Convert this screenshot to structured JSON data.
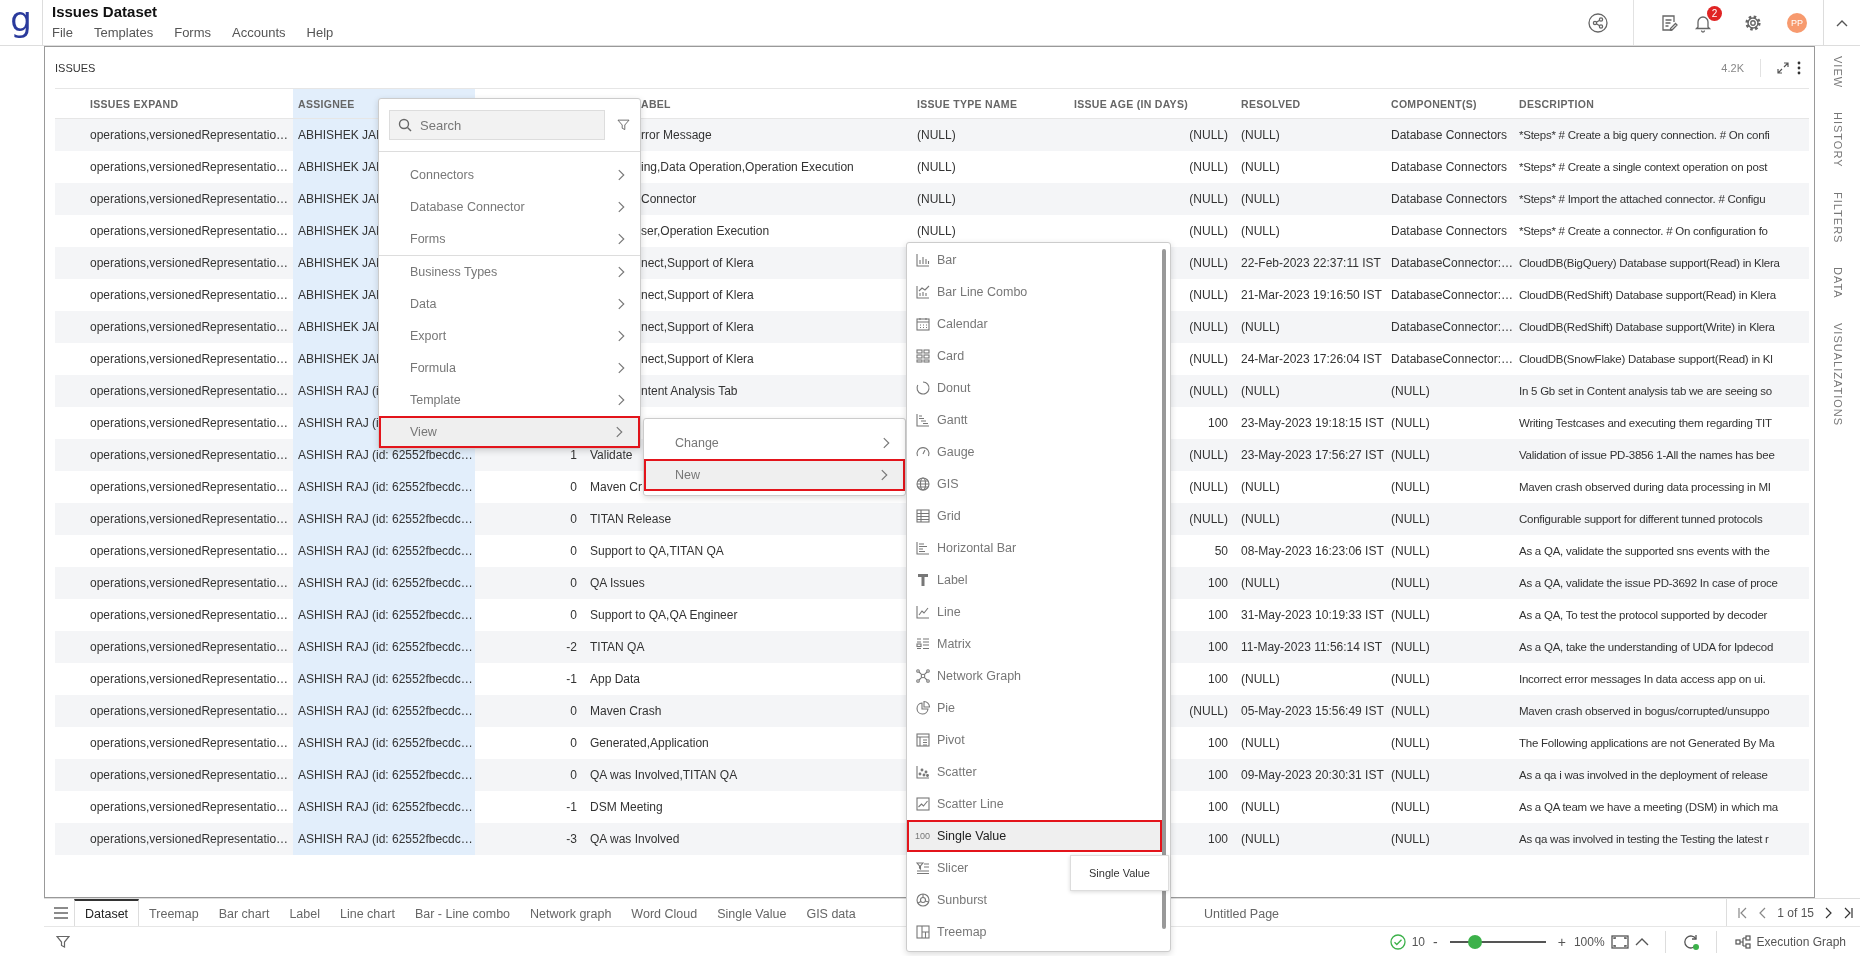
{
  "app": {
    "logo": "g",
    "title": "Issues Dataset",
    "menu": [
      "File",
      "Templates",
      "Forms",
      "Accounts",
      "Help"
    ],
    "notification_count": "2",
    "avatar": "PP"
  },
  "side_panel": [
    "VIEW",
    "HISTORY",
    "FILTERS",
    "DATA",
    "VISUALIZATIONS"
  ],
  "card": {
    "title": "ISSUES",
    "count": "4.2K"
  },
  "table": {
    "columns": [
      {
        "title": "ISSUES EXPAND",
        "selected": false
      },
      {
        "title": "ASSIGNEE",
        "selected": true
      },
      {
        "selected": false
      },
      {
        "title": "ABEL",
        "selected": false
      },
      {
        "title": "ISSUE TYPE NAME",
        "selected": false
      },
      {
        "title": "ISSUE AGE (IN DAYS)",
        "selected": false
      },
      {
        "title": "RESOLVED",
        "selected": false
      },
      {
        "title": "COMPONENT(S)",
        "selected": false
      },
      {
        "title": "DESCRIPTION",
        "selected": false
      }
    ],
    "rows": [
      [
        "operations,versionedRepresentatio…",
        "ABHISHEK JAI",
        null,
        "rror Message",
        "(NULL)",
        "(NULL)",
        "(NULL)",
        "Database Connectors",
        "*Steps* # Create a big query connection. # On confi"
      ],
      [
        "operations,versionedRepresentatio…",
        "ABHISHEK JAI",
        null,
        "ing,Data Operation,Operation Execution",
        "(NULL)",
        "(NULL)",
        "(NULL)",
        "Database Connectors",
        "*Steps* # Create a single context operation on post"
      ],
      [
        "operations,versionedRepresentatio…",
        "ABHISHEK JAI",
        null,
        "Connector",
        "(NULL)",
        "(NULL)",
        "(NULL)",
        "Database Connectors",
        "*Steps* # Import the attached connector. # Configu"
      ],
      [
        "operations,versionedRepresentatio…",
        "ABHISHEK JAI",
        null,
        "ser,Operation Execution",
        "(NULL)",
        "(NULL)",
        "(NULL)",
        "Database Connectors",
        "*Steps* # Create a connector. # On configuration fo"
      ],
      [
        "operations,versionedRepresentatio…",
        "ABHISHEK JAI",
        null,
        "nect,Support of Klera",
        null,
        "(NULL)",
        "22-Feb-2023 22:37:11 IST",
        "DatabaseConnector:…",
        "CloudDB(BigQuery) Database support(Read) in Klera"
      ],
      [
        "operations,versionedRepresentatio…",
        "ABHISHEK JAI",
        null,
        "nect,Support of Klera",
        null,
        "(NULL)",
        "21-Mar-2023 19:16:50 IST",
        "DatabaseConnector:…",
        "CloudDB(RedShift) Database support(Read) in Klera"
      ],
      [
        "operations,versionedRepresentatio…",
        "ABHISHEK JAI",
        null,
        "nect,Support of Klera",
        null,
        "(NULL)",
        "(NULL)",
        "DatabaseConnector:…",
        "CloudDB(RedShift) Database support(Write) in Klera"
      ],
      [
        "operations,versionedRepresentatio…",
        "ABHISHEK JAI",
        null,
        "nect,Support of Klera",
        null,
        "(NULL)",
        "24-Mar-2023 17:26:04 IST",
        "DatabaseConnector:…",
        "CloudDB(SnowFlake) Database support(Read) in Kl"
      ],
      [
        "operations,versionedRepresentatio…",
        "ASHISH RAJ (i",
        null,
        "ntent Analysis Tab",
        null,
        "(NULL)",
        "(NULL)",
        "(NULL)",
        "In 5 Gb set in Content analysis tab we are seeing so"
      ],
      [
        "operations,versionedRepresentatio…",
        "ASHISH RAJ (i",
        null,
        null,
        null,
        "100",
        "23-May-2023 19:18:15 IST",
        "(NULL)",
        "Writing Testcases and executing them regarding TIT"
      ],
      [
        "operations,versionedRepresentatio…",
        "ASHISH RAJ (id: 62552fbecdc…",
        "1",
        "Validate",
        null,
        "(NULL)",
        "23-May-2023 17:56:27 IST",
        "(NULL)",
        "Validation of issue PD-3856 1-All the names has bee"
      ],
      [
        "operations,versionedRepresentatio…",
        "ASHISH RAJ (id: 62552fbecdc…",
        "0",
        "Maven Cr",
        null,
        "(NULL)",
        "(NULL)",
        "(NULL)",
        "Maven crash observed during data processing in MI"
      ],
      [
        "operations,versionedRepresentatio…",
        "ASHISH RAJ (id: 62552fbecdc…",
        "0",
        "TITAN Release",
        null,
        "(NULL)",
        "(NULL)",
        "(NULL)",
        "Configurable support for different tunned protocols"
      ],
      [
        "operations,versionedRepresentatio…",
        "ASHISH RAJ (id: 62552fbecdc…",
        "0",
        "Support to QA,TITAN QA",
        null,
        "50",
        "08-May-2023 16:23:06 IST",
        "(NULL)",
        "As a QA, validate the supported sns events with the"
      ],
      [
        "operations,versionedRepresentatio…",
        "ASHISH RAJ (id: 62552fbecdc…",
        "0",
        "QA Issues",
        null,
        "100",
        "(NULL)",
        "(NULL)",
        "As a QA, validate the issue PD-3692 In case of proce"
      ],
      [
        "operations,versionedRepresentatio…",
        "ASHISH RAJ (id: 62552fbecdc…",
        "0",
        "Support to QA,QA Engineer",
        null,
        "100",
        "31-May-2023 10:19:33 IST",
        "(NULL)",
        "As a QA, To test the protocol supported by decoder"
      ],
      [
        "operations,versionedRepresentatio…",
        "ASHISH RAJ (id: 62552fbecdc…",
        "-2",
        "TITAN QA",
        null,
        "100",
        "11-May-2023 11:56:14 IST",
        "(NULL)",
        "As a QA, take the understanding of UDA for Ipdecod"
      ],
      [
        "operations,versionedRepresentatio…",
        "ASHISH RAJ (id: 62552fbecdc…",
        "-1",
        "App Data",
        null,
        "100",
        "(NULL)",
        "(NULL)",
        "Incorrect error messages In data access app on ui."
      ],
      [
        "operations,versionedRepresentatio…",
        "ASHISH RAJ (id: 62552fbecdc…",
        "0",
        "Maven Crash",
        null,
        "(NULL)",
        "05-May-2023 15:56:49 IST",
        "(NULL)",
        "Maven crash observed in bogus/corrupted/unsuppo"
      ],
      [
        "operations,versionedRepresentatio…",
        "ASHISH RAJ (id: 62552fbecdc…",
        "0",
        "Generated,Application",
        null,
        "100",
        "(NULL)",
        "(NULL)",
        "The Following applications are not Generated By Ma"
      ],
      [
        "operations,versionedRepresentatio…",
        "ASHISH RAJ (id: 62552fbecdc…",
        "0",
        "QA was Involved,TITAN QA",
        null,
        "100",
        "09-May-2023 20:30:31 IST",
        "(NULL)",
        "As a qa i was involved in the deployment of release"
      ],
      [
        "operations,versionedRepresentatio…",
        "ASHISH RAJ (id: 62552fbecdc…",
        "-1",
        "DSM Meeting",
        null,
        "100",
        "(NULL)",
        "(NULL)",
        "As a QA team we have a meeting (DSM) in which ma"
      ],
      [
        "operations,versionedRepresentatio…",
        "ASHISH RAJ (id: 62552fbecdc…",
        "-3",
        "QA was Involved",
        null,
        "100",
        "(NULL)",
        "(NULL)",
        "As qa was involved in testing the Testing the latest r"
      ]
    ]
  },
  "context_menu": {
    "search": {
      "placeholder": "Search"
    },
    "groups": [
      [
        {
          "label": "Connectors",
          "selected": false
        },
        {
          "label": "Database Connector",
          "selected": false
        },
        {
          "label": "Forms",
          "selected": false
        }
      ],
      [
        {
          "label": "Business Types",
          "selected": false
        },
        {
          "label": "Data",
          "selected": false
        },
        {
          "label": "Export",
          "selected": false
        },
        {
          "label": "Formula",
          "selected": false
        },
        {
          "label": "Template",
          "selected": false
        },
        {
          "label": "View",
          "selected": true
        }
      ]
    ]
  },
  "submenu": {
    "items": [
      {
        "label": "Change",
        "selected": false
      },
      {
        "label": "New",
        "selected": true
      }
    ]
  },
  "visualization_menu": {
    "items": [
      {
        "label": "Bar",
        "selected": false
      },
      {
        "label": "Bar Line Combo",
        "selected": false
      },
      {
        "label": "Calendar",
        "selected": false
      },
      {
        "label": "Card",
        "selected": false
      },
      {
        "label": "Donut",
        "selected": false
      },
      {
        "label": "Gantt",
        "selected": false
      },
      {
        "label": "Gauge",
        "selected": false
      },
      {
        "label": "GIS",
        "selected": false
      },
      {
        "label": "Grid",
        "selected": false
      },
      {
        "label": "Horizontal Bar",
        "selected": false
      },
      {
        "label": "Label",
        "selected": false
      },
      {
        "label": "Line",
        "selected": false
      },
      {
        "label": "Matrix",
        "selected": false
      },
      {
        "label": "Network Graph",
        "selected": false
      },
      {
        "label": "Pie",
        "selected": false
      },
      {
        "label": "Pivot",
        "selected": false
      },
      {
        "label": "Scatter",
        "selected": false
      },
      {
        "label": "Scatter Line",
        "selected": false
      },
      {
        "label": "Single Value",
        "selected": true,
        "badge": "100"
      },
      {
        "label": "Slicer",
        "selected": false
      },
      {
        "label": "Sunburst",
        "selected": false
      },
      {
        "label": "Treemap",
        "selected": false
      }
    ]
  },
  "tooltip": "Single Value",
  "page_tabs": [
    {
      "label": "Dataset",
      "selected": true
    },
    {
      "label": "Treemap",
      "selected": false
    },
    {
      "label": "Bar chart",
      "selected": false
    },
    {
      "label": "Label",
      "selected": false
    },
    {
      "label": "Line chart",
      "selected": false
    },
    {
      "label": "Bar - Line combo",
      "selected": false
    },
    {
      "label": "Network graph",
      "selected": false
    },
    {
      "label": "Word Cloud",
      "selected": false
    },
    {
      "label": "Single Value",
      "selected": false
    },
    {
      "label": "GIS data",
      "selected": false
    },
    {
      "label": "Untitled Page",
      "selected": false
    }
  ],
  "pagination": {
    "text": "1 of 15"
  },
  "status_bar": {
    "check_count": "10",
    "zoom_minus": "-",
    "zoom_slider": {
      "level": 0.26
    },
    "zoom_plus": "+",
    "zoom_percent": "100%",
    "execution_graph": "Execution Graph"
  }
}
